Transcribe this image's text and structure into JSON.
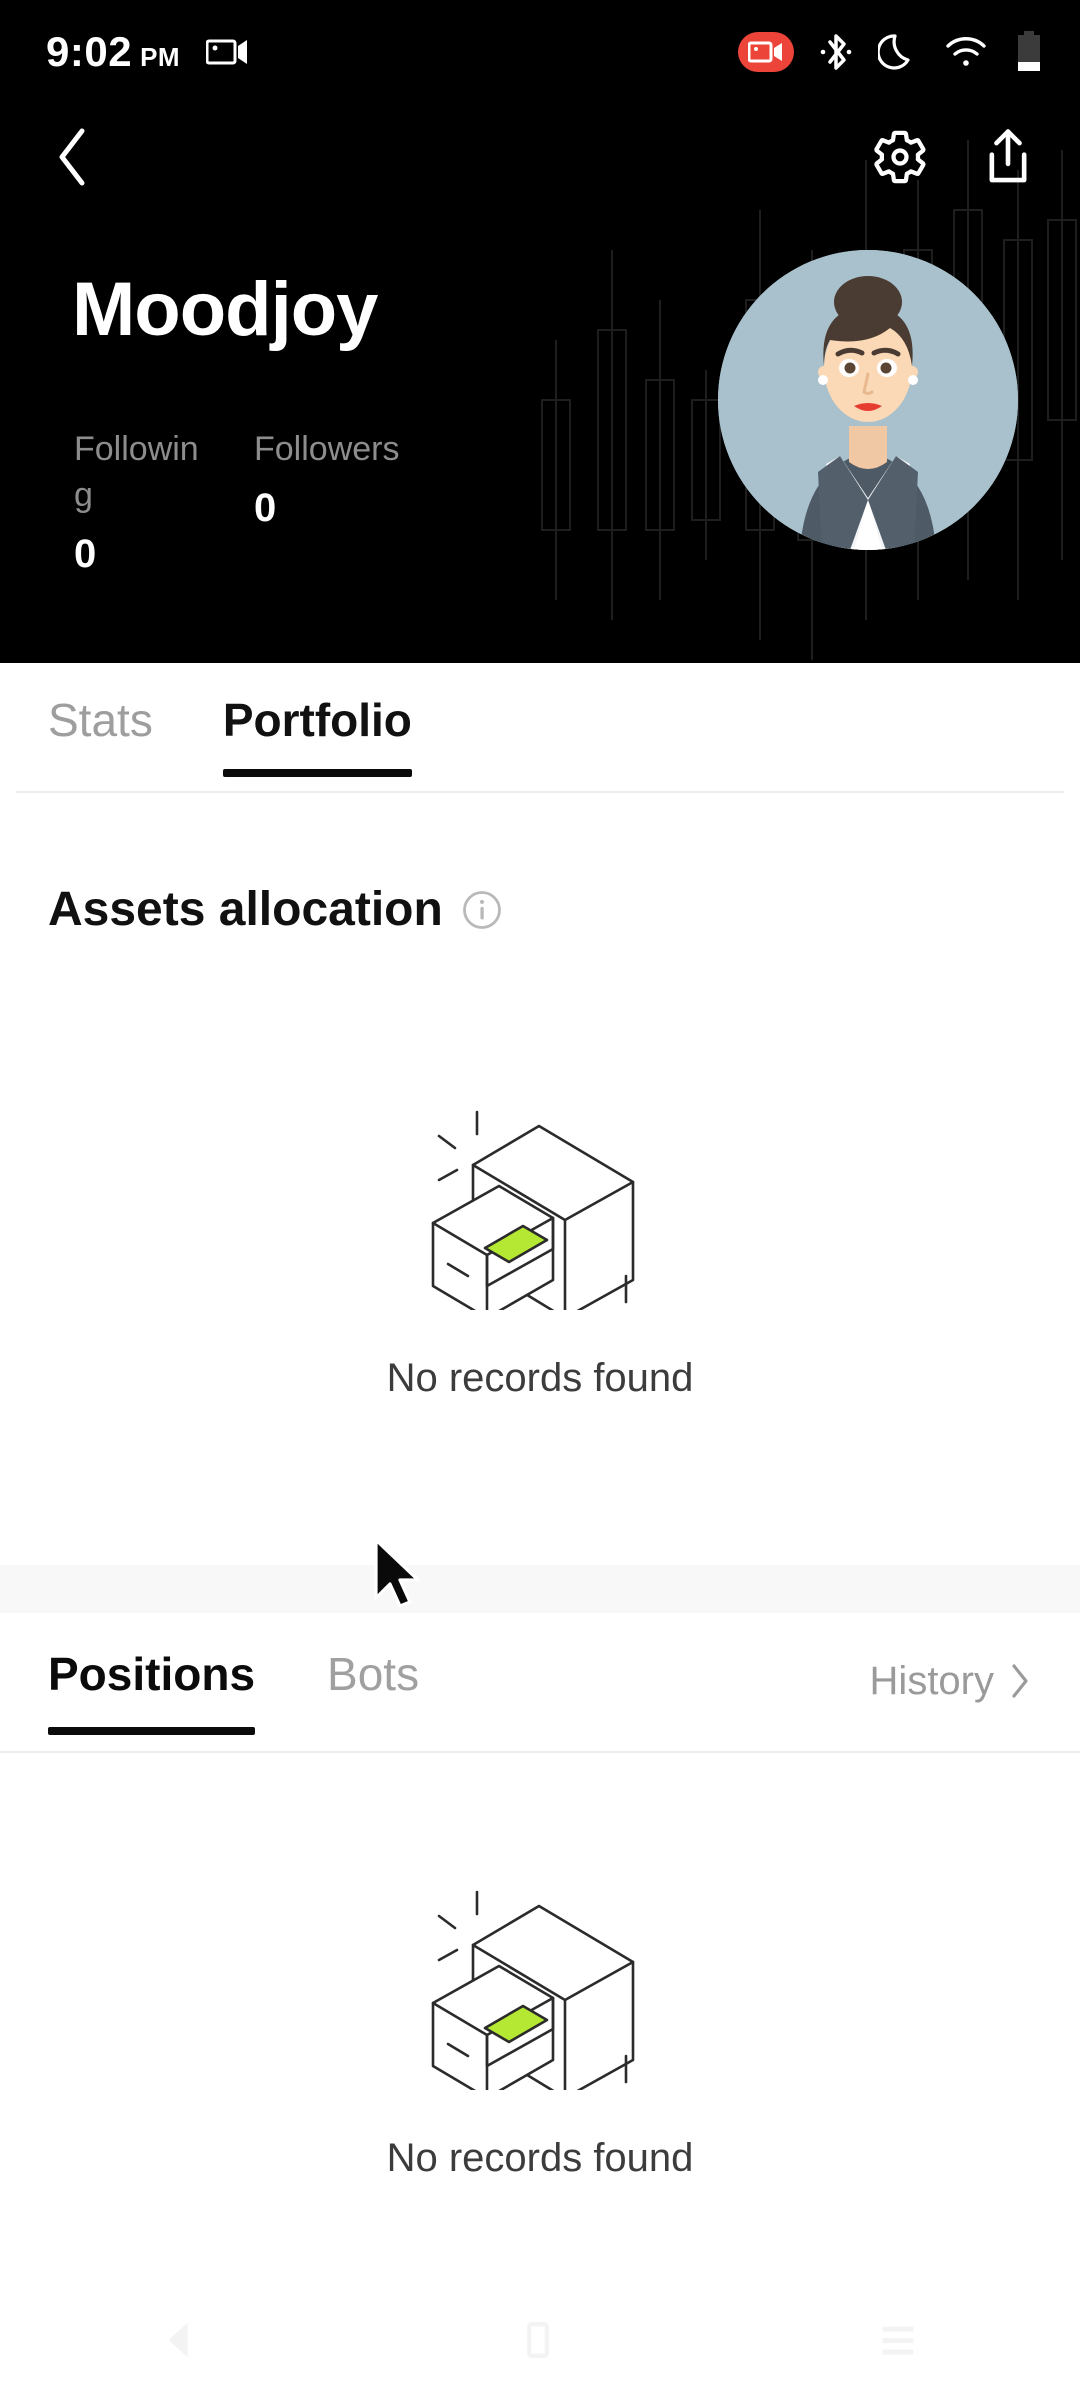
{
  "status_bar": {
    "time": "9:02",
    "ampm": "PM",
    "icons": [
      "screen-record-icon",
      "screen-recording-badge-icon",
      "bluetooth-icon",
      "do-not-disturb-moon-icon",
      "wifi-icon",
      "battery-icon"
    ],
    "recording_badge_color": "#ec4438",
    "battery_level_percent": 25
  },
  "nav": {
    "back_icon": "chevron-left-icon",
    "settings_icon": "gear-icon",
    "share_icon": "share-upload-icon"
  },
  "profile": {
    "username": "Moodjoy",
    "avatar_icon": "avatar-businesswoman",
    "avatar_bg": "#a9c1cc",
    "stats": [
      {
        "label": "Following",
        "value": "0"
      },
      {
        "label": "Followers",
        "value": "0"
      }
    ]
  },
  "top_tabs": [
    {
      "label": "Stats",
      "active": false
    },
    {
      "label": "Portfolio",
      "active": true
    }
  ],
  "assets_section": {
    "title": "Assets allocation",
    "info_icon": "info-circle-icon",
    "empty_state": {
      "illustration": "empty-drawer-illustration",
      "text": "No records found",
      "accent_color": "#b4e832"
    }
  },
  "bottom_tabs": [
    {
      "label": "Positions",
      "active": true
    },
    {
      "label": "Bots",
      "active": false
    }
  ],
  "history_link": {
    "label": "History",
    "chevron_icon": "chevron-right-icon"
  },
  "positions_section": {
    "empty_state": {
      "illustration": "empty-drawer-illustration",
      "text": "No records found"
    }
  },
  "system_nav": {
    "back_icon": "triangle-back-icon",
    "home_icon": "square-home-icon",
    "recents_icon": "lines-recents-icon"
  },
  "cursor": {
    "icon": "mouse-pointer-icon"
  }
}
